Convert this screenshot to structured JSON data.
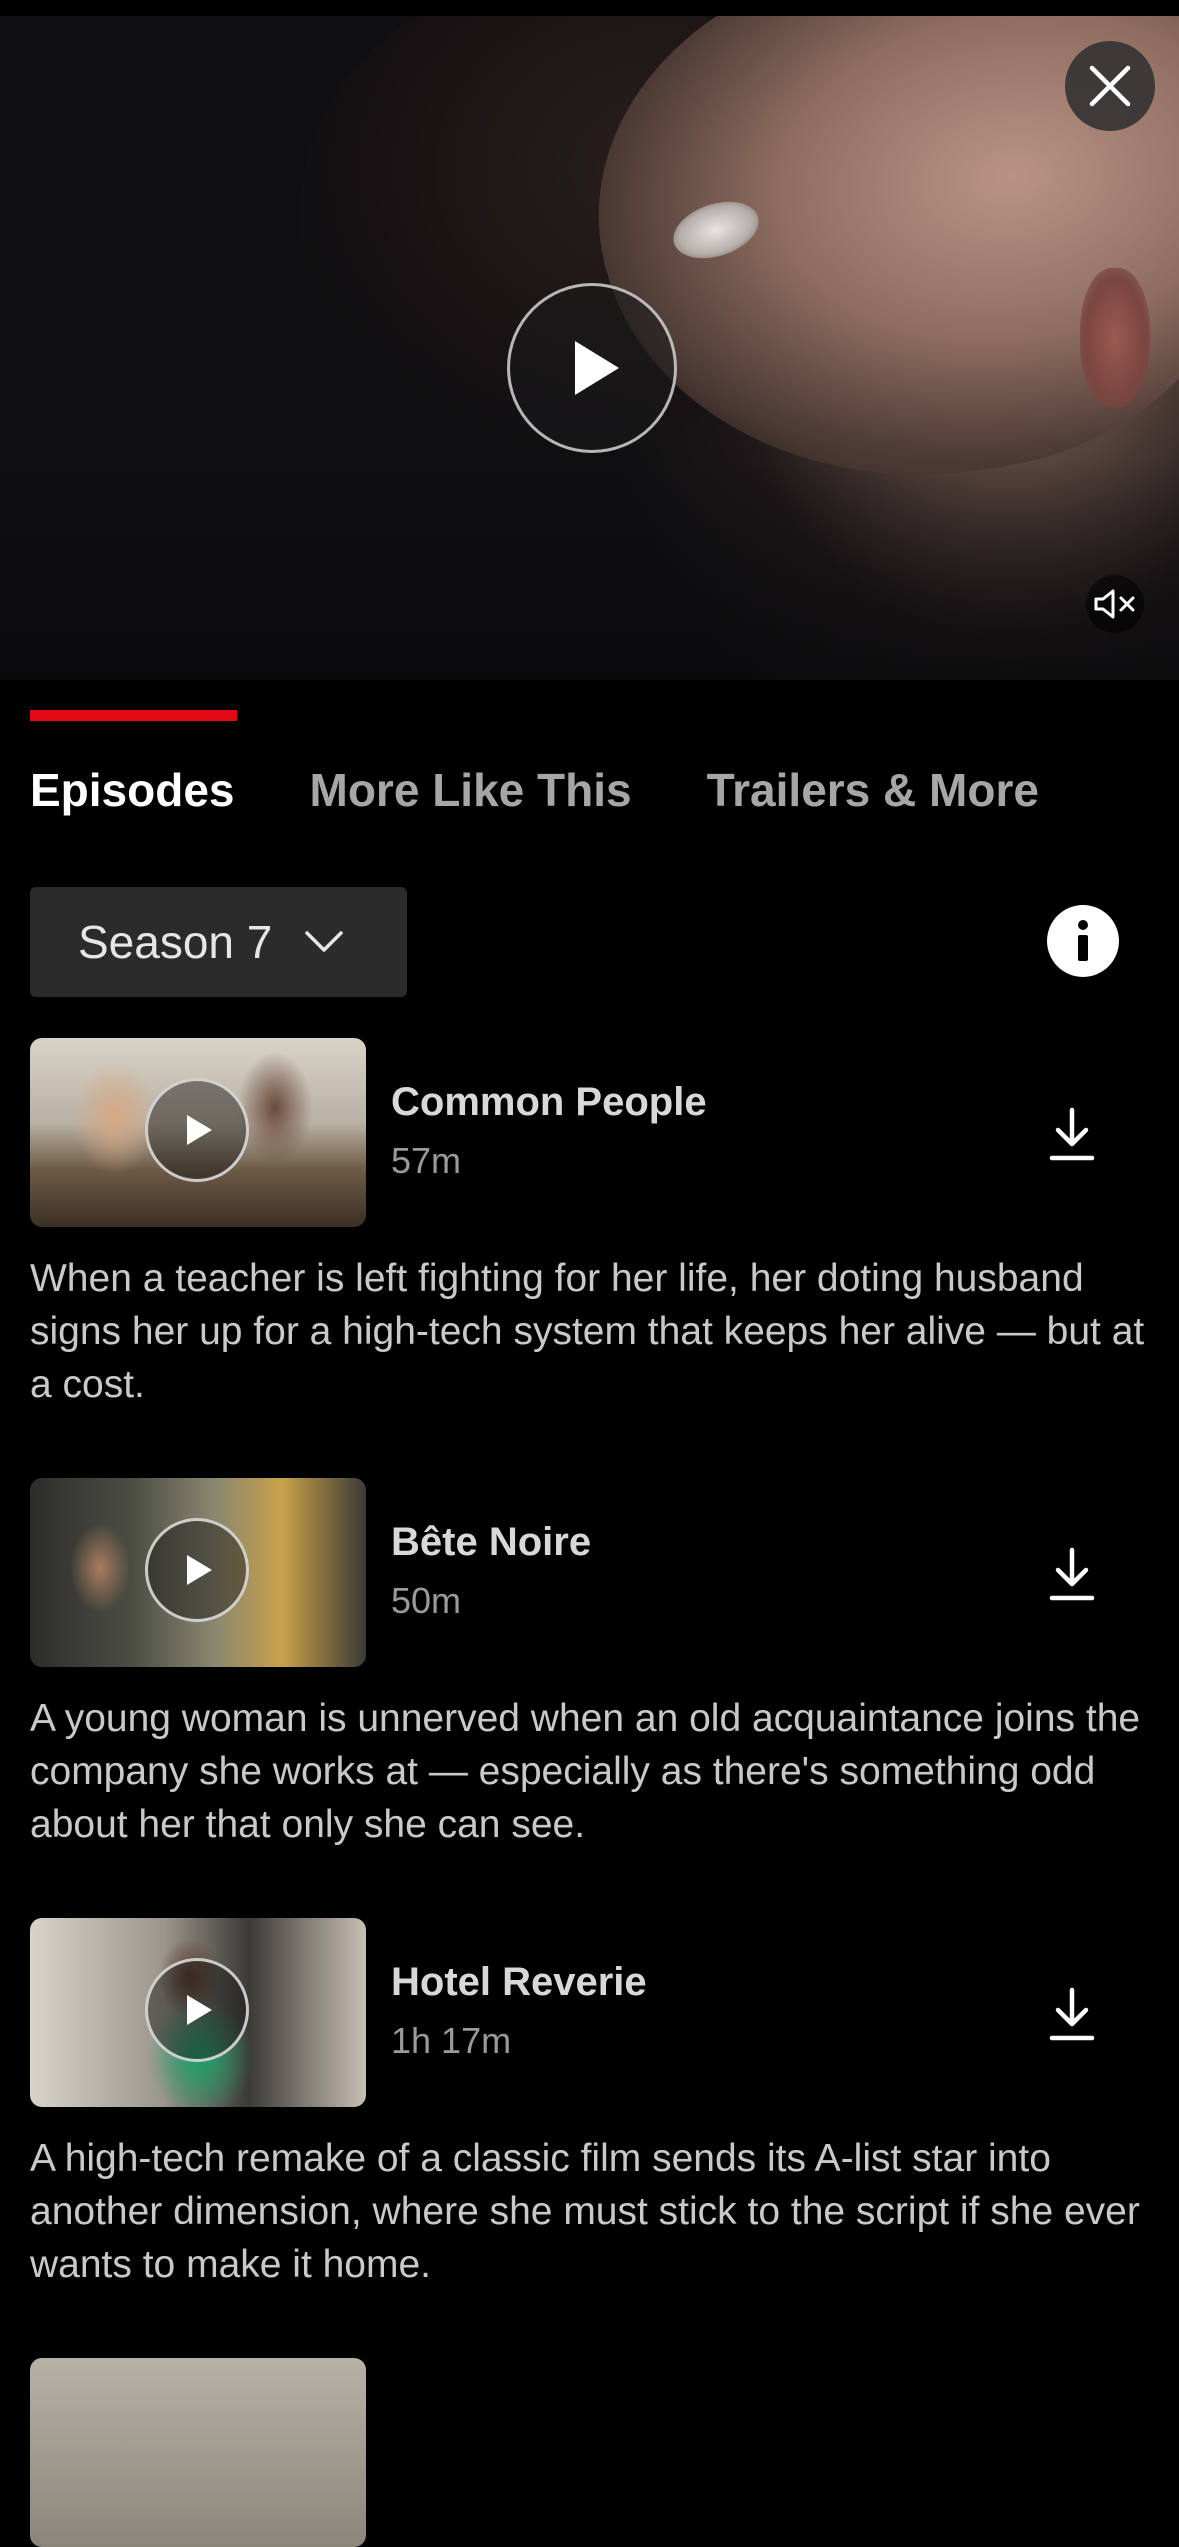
{
  "header": {
    "close_icon": "close-icon",
    "play_icon": "play-icon",
    "mute_icon": "speaker-muted-icon"
  },
  "tabs": [
    {
      "label": "Episodes",
      "active": true
    },
    {
      "label": "More Like This",
      "active": false
    },
    {
      "label": "Trailers & More",
      "active": false
    }
  ],
  "season": {
    "label": "Season 7",
    "chevron_icon": "chevron-down-icon",
    "info_icon": "info-icon"
  },
  "episodes": [
    {
      "title": "Common People",
      "duration": "57m",
      "description": "When a teacher is left fighting for her life, her doting husband signs her up for a high-tech system that keeps her alive — but at a cost."
    },
    {
      "title": "Bête Noire",
      "duration": "50m",
      "description": "A young woman is unnerved when an old acquaintance joins the company she works at — especially as there's something odd about her that only she can see."
    },
    {
      "title": "Hotel Reverie",
      "duration": "1h 17m",
      "description": "A high-tech remake of a classic film sends its A-list star into another dimension, where she must stick to the script if she ever wants to make it home."
    }
  ],
  "colors": {
    "accent": "#e50914",
    "background": "#000000",
    "select_background": "#2b2b2b"
  }
}
